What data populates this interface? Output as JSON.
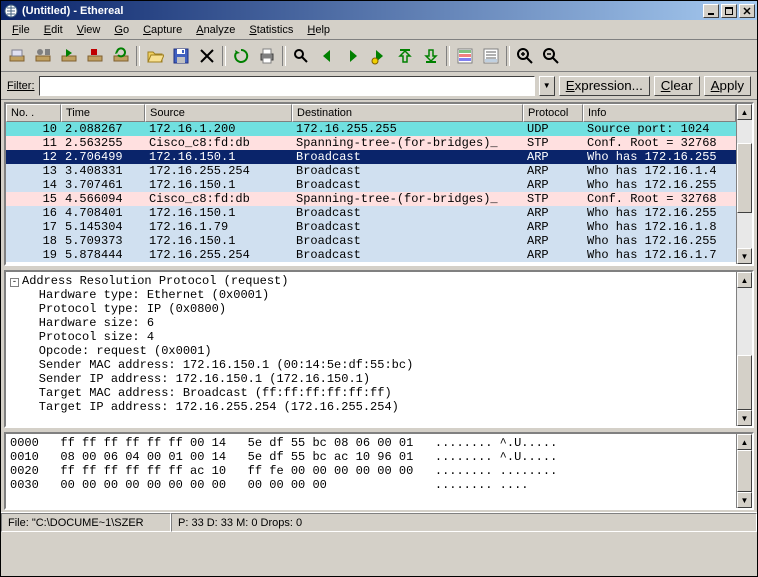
{
  "title": "(Untitled) - Ethereal",
  "menu": [
    "File",
    "Edit",
    "View",
    "Go",
    "Capture",
    "Analyze",
    "Statistics",
    "Help"
  ],
  "filter": {
    "label": "Filter:",
    "value": "",
    "expression": "Expression...",
    "clear": "Clear",
    "apply": "Apply"
  },
  "columns": {
    "no": "No. .",
    "time": "Time",
    "src": "Source",
    "dst": "Destination",
    "proto": "Protocol",
    "info": "Info"
  },
  "packets": [
    {
      "no": "10",
      "time": "2.088267",
      "src": "172.16.1.200",
      "dst": "172.16.255.255",
      "proto": "UDP",
      "info": "Source port: 1024",
      "cls": "row-cyan"
    },
    {
      "no": "11",
      "time": "2.563255",
      "src": "Cisco_c8:fd:db",
      "dst": "Spanning-tree-(for-bridges)_",
      "proto": "STP",
      "info": "Conf. Root = 32768",
      "cls": "row-pink"
    },
    {
      "no": "12",
      "time": "2.706499",
      "src": "172.16.150.1",
      "dst": "Broadcast",
      "proto": "ARP",
      "info": "Who has 172.16.255",
      "cls": "row-sel"
    },
    {
      "no": "13",
      "time": "3.408331",
      "src": "172.16.255.254",
      "dst": "Broadcast",
      "proto": "ARP",
      "info": "Who has 172.16.1.4",
      "cls": "row-lblue"
    },
    {
      "no": "14",
      "time": "3.707461",
      "src": "172.16.150.1",
      "dst": "Broadcast",
      "proto": "ARP",
      "info": "Who has 172.16.255",
      "cls": "row-lblue"
    },
    {
      "no": "15",
      "time": "4.566094",
      "src": "Cisco_c8:fd:db",
      "dst": "Spanning-tree-(for-bridges)_",
      "proto": "STP",
      "info": "Conf. Root = 32768",
      "cls": "row-pink"
    },
    {
      "no": "16",
      "time": "4.708401",
      "src": "172.16.150.1",
      "dst": "Broadcast",
      "proto": "ARP",
      "info": "Who has 172.16.255",
      "cls": "row-lblue"
    },
    {
      "no": "17",
      "time": "5.145304",
      "src": "172.16.1.79",
      "dst": "Broadcast",
      "proto": "ARP",
      "info": "Who has 172.16.1.8",
      "cls": "row-lblue"
    },
    {
      "no": "18",
      "time": "5.709373",
      "src": "172.16.150.1",
      "dst": "Broadcast",
      "proto": "ARP",
      "info": "Who has 172.16.255",
      "cls": "row-lblue"
    },
    {
      "no": "19",
      "time": "5.878444",
      "src": "172.16.255.254",
      "dst": "Broadcast",
      "proto": "ARP",
      "info": "Who has 172.16.1.7",
      "cls": "row-lblue"
    }
  ],
  "details": [
    "Address Resolution Protocol (request)",
    "    Hardware type: Ethernet (0x0001)",
    "    Protocol type: IP (0x0800)",
    "    Hardware size: 6",
    "    Protocol size: 4",
    "    Opcode: request (0x0001)",
    "    Sender MAC address: 172.16.150.1 (00:14:5e:df:55:bc)",
    "    Sender IP address: 172.16.150.1 (172.16.150.1)",
    "    Target MAC address: Broadcast (ff:ff:ff:ff:ff:ff)",
    "    Target IP address: 172.16.255.254 (172.16.255.254)"
  ],
  "hex": [
    "0000   ff ff ff ff ff ff 00 14   5e df 55 bc 08 06 00 01   ........ ^.U.....",
    "0010   08 00 06 04 00 01 00 14   5e df 55 bc ac 10 96 01   ........ ^.U.....",
    "0020   ff ff ff ff ff ff ac 10   ff fe 00 00 00 00 00 00   ........ ........",
    "0030   00 00 00 00 00 00 00 00   00 00 00 00               ........ ...."
  ],
  "status": {
    "file": "File: \"C:\\DOCUME~1\\SZER",
    "pkts": "P: 33 D: 33 M: 0 Drops: 0"
  }
}
